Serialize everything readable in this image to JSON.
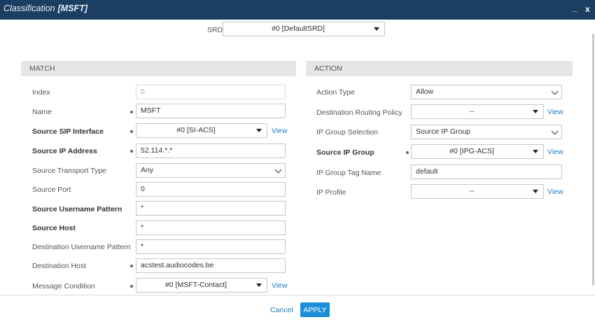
{
  "dialog": {
    "title": "Classification",
    "object": "[MSFT]",
    "min_glyph": "_",
    "close_glyph": "x"
  },
  "srd": {
    "label": "SRD",
    "value": "#0 [DefaultSRD]"
  },
  "match": {
    "header": "MATCH",
    "index": {
      "label": "Index",
      "value": "0"
    },
    "name": {
      "label": "Name",
      "value": "MSFT"
    },
    "source_sip_interface": {
      "label": "Source SIP Interface",
      "value": "#0 [SI-ACS]"
    },
    "source_ip_address": {
      "label": "Source IP Address",
      "value": "52.114.*.*"
    },
    "source_transport_type": {
      "label": "Source Transport Type",
      "value": "Any"
    },
    "source_port": {
      "label": "Source Port",
      "value": "0"
    },
    "source_username_pattern": {
      "label": "Source Username Pattern",
      "value": "*"
    },
    "source_host": {
      "label": "Source Host",
      "value": "*"
    },
    "destination_username_pattern": {
      "label": "Destination Username Pattern",
      "value": "*"
    },
    "destination_host": {
      "label": "Destination Host",
      "value": "acstest.audiocodes.be"
    },
    "message_condition": {
      "label": "Message Condition",
      "value": "#0 [MSFT-Contact]"
    }
  },
  "action": {
    "header": "ACTION",
    "action_type": {
      "label": "Action Type",
      "value": "Allow"
    },
    "destination_routing_policy": {
      "label": "Destination Routing Policy",
      "value": "--"
    },
    "ip_group_selection": {
      "label": "IP Group Selection",
      "value": "Source IP Group"
    },
    "source_ip_group": {
      "label": "Source IP Group",
      "value": "#0 [IPG-ACS]"
    },
    "ip_group_tag_name": {
      "label": "IP Group Tag Name",
      "value": "default"
    },
    "ip_profile": {
      "label": "IP Profile",
      "value": "--"
    }
  },
  "links": {
    "view": "View"
  },
  "footer": {
    "cancel": "Cancel",
    "apply": "APPLY"
  }
}
